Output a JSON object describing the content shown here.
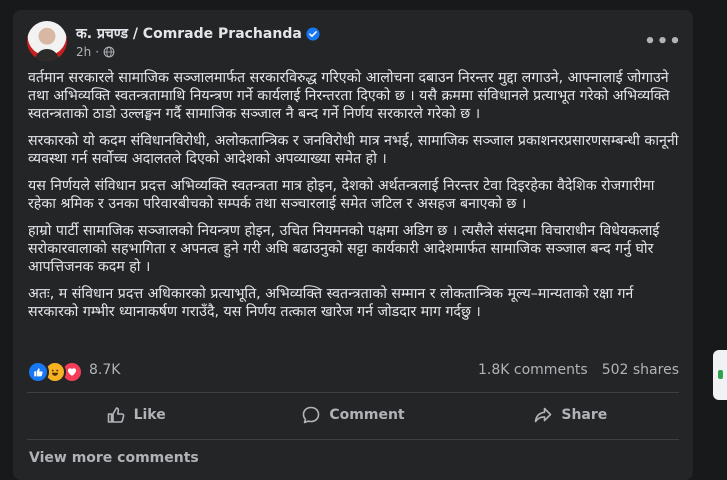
{
  "post": {
    "author": "क. प्रचण्ड / Comrade Prachanda",
    "time": "2h",
    "more_label": "•••",
    "paragraphs": [
      "वर्तमान सरकारले सामाजिक सञ्जालमार्फत सरकारविरुद्ध गरिएको आलोचना दबाउन निरन्तर मुद्दा लगाउने, आफ्नालाई जोगाउने तथा अभिव्यक्ति स्वतन्त्रतामाथि नियन्त्रण गर्ने कार्यलाई निरन्तरता दिएको छ । यसै क्रममा संविधानले प्रत्याभूत गरेको अभिव्यक्ति स्वतन्त्रताको ठाडो उल्लङ्घन गर्दै सामाजिक सञ्जाल नै बन्द गर्ने निर्णय सरकारले गरेको छ ।",
      "सरकारको यो कदम संविधानविरोधी, अलोकतान्त्रिक र जनविरोधी मात्र नभई, सामाजिक सञ्जाल प्रकाशनरप्रसारणसम्बन्धी कानूनी व्यवस्था गर्न सर्वोच्च अदालतले दिएको आदेशको अपव्याख्या समेत हो ।",
      "यस निर्णयले संविधान प्रदत्त अभिव्यक्ति स्वतन्त्रता मात्र होइन, देशको अर्थतन्त्रलाई निरन्तर टेवा दिइरहेका वैदेशिक रोजगारीमा रहेका श्रमिक र उनका परिवारबीचको सम्पर्क तथा सञ्चारलाई समेत जटिल र असहज बनाएको छ ।",
      "हाम्रो पार्टी सामाजिक सञ्जालको नियन्त्रण होइन, उचित नियमनको पक्षमा अडिग छ । त्यसैले संसदमा विचाराधीन विधेयकलाई सरोकारवालाको सहभागिता र अपनत्व हुने गरी अघि बढाउनुको सट्टा कार्यकारी आदेशमार्फत सामाजिक सञ्जाल बन्द गर्नु घोर आपत्तिजनक कदम हो ।",
      "अतः, म संविधान प्रदत्त अधिकारको प्रत्याभूति, अभिव्यक्ति स्वतन्त्रताको सम्मान र लोकतान्त्रिक मूल्य–मान्यताको रक्षा गर्न सरकारको गम्भीर ध्यानाकर्षण गराउँदै, यस निर्णय तत्काल खारेज गर्न जोडदार माग गर्दछु ।"
    ],
    "reaction_count": "8.7K",
    "comments_count": "1.8K comments",
    "shares_count": "502 shares"
  },
  "actions": {
    "like": "Like",
    "comment": "Comment",
    "share": "Share"
  },
  "view_more": "View more comments",
  "icons": [
    "verified-badge-icon",
    "globe-icon",
    "more-options-icon",
    "like-reaction-icon",
    "haha-reaction-icon",
    "love-reaction-icon",
    "thumbs-up-icon",
    "comment-bubble-icon",
    "share-arrow-icon"
  ],
  "colors": {
    "background": "#18191a",
    "card": "#242526",
    "text": "#e4e6eb",
    "muted": "#b0b3b8",
    "accent": "#1877f2"
  }
}
